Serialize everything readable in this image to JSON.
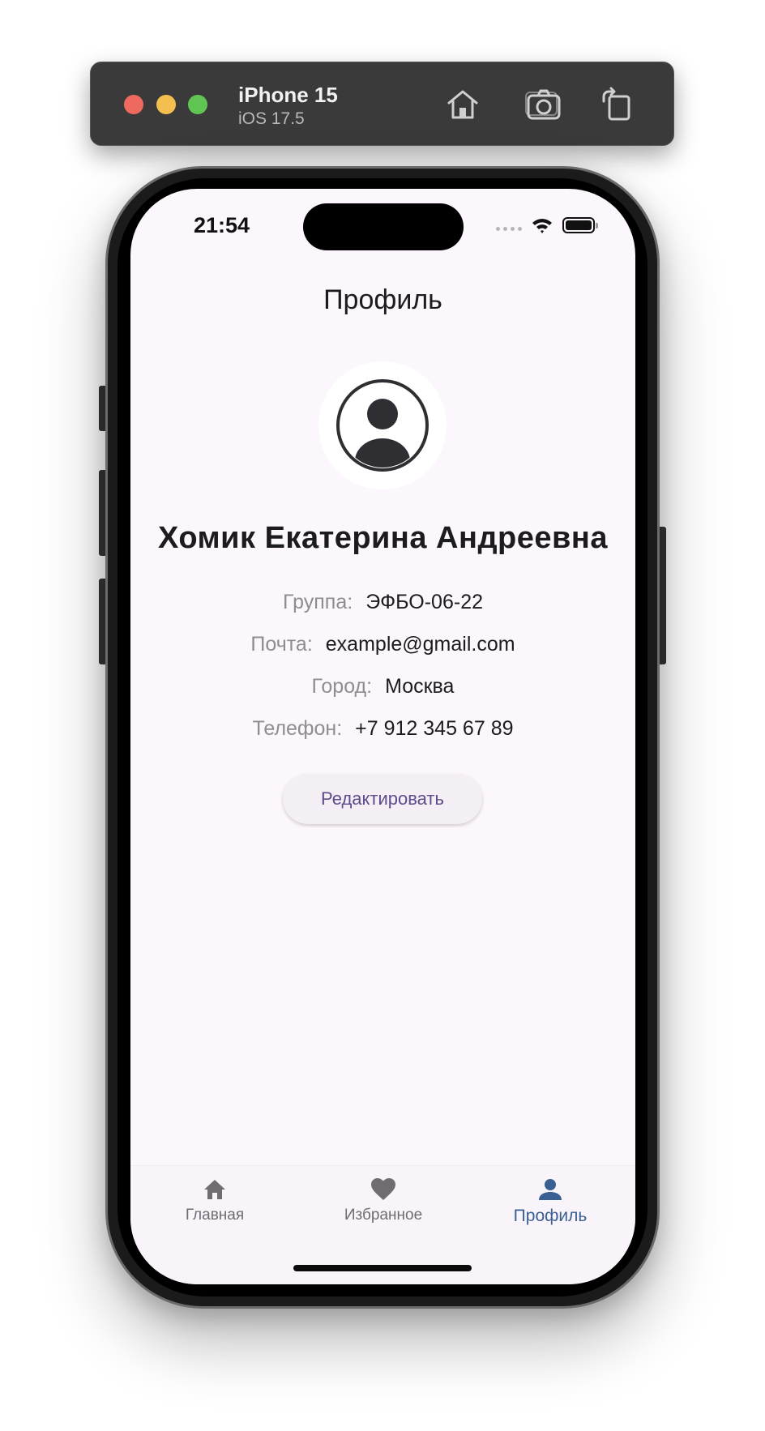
{
  "simulator": {
    "device_name": "iPhone 15",
    "os_version": "iOS 17.5",
    "icons": [
      "home-icon",
      "screenshot-icon",
      "rotate-icon"
    ]
  },
  "status_bar": {
    "time": "21:54",
    "icons": [
      "signal-dots-icon",
      "wifi-icon",
      "battery-icon"
    ]
  },
  "page": {
    "title": "Профиль"
  },
  "profile": {
    "avatar_icon": "account-circle-icon",
    "full_name": "Хомик Екатерина Андреевна",
    "fields": [
      {
        "label": "Группа:",
        "value": "ЭФБО-06-22"
      },
      {
        "label": "Почта:",
        "value": "example@gmail.com"
      },
      {
        "label": "Город:",
        "value": "Москва"
      },
      {
        "label": "Телефон:",
        "value": "+7 912 345 67 89"
      }
    ],
    "edit_button": "Редактировать"
  },
  "bottom_nav": {
    "items": [
      {
        "label": "Главная",
        "icon": "home-icon",
        "active": false
      },
      {
        "label": "Избранное",
        "icon": "heart-icon",
        "active": false
      },
      {
        "label": "Профиль",
        "icon": "person-icon",
        "active": true
      }
    ]
  },
  "colors": {
    "screen_bg": "#fcf7fc",
    "accent_active": "#3a5f93",
    "button_text": "#5f4b8b",
    "label_gray": "#8f8c92"
  }
}
